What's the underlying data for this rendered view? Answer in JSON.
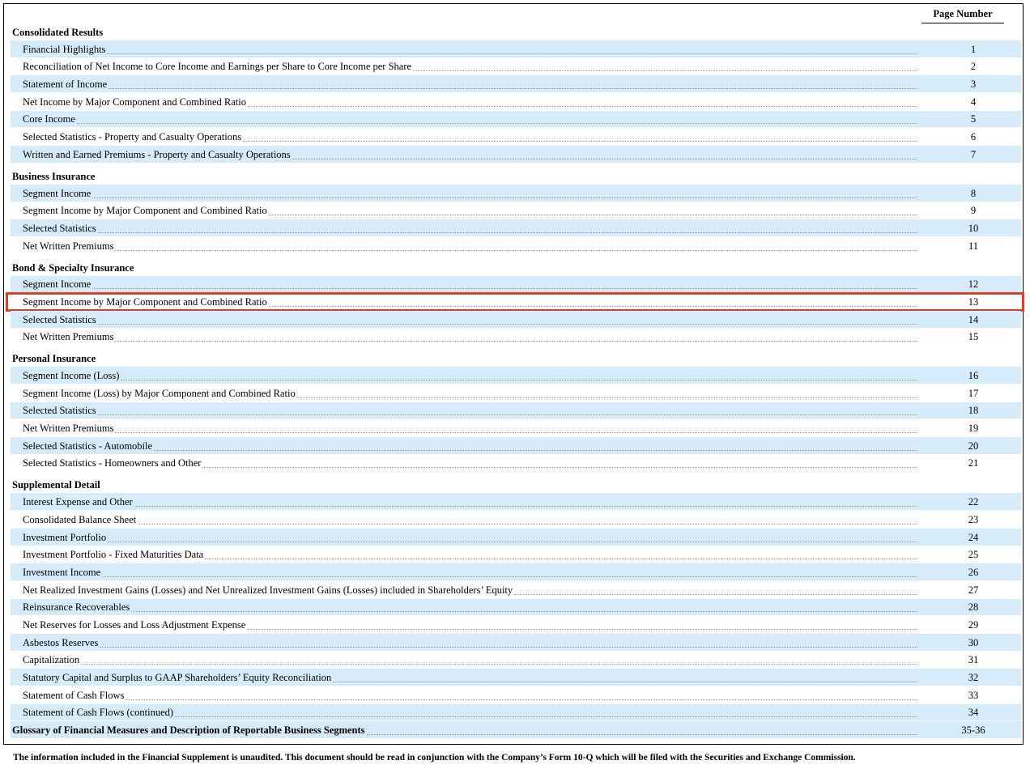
{
  "header": {
    "page_number_label": "Page Number"
  },
  "sections": [
    {
      "title": "Consolidated Results",
      "items": [
        {
          "label": "Financial Highlights",
          "page": "1"
        },
        {
          "label": "Reconciliation of Net Income to Core Income and Earnings per Share to Core Income per Share",
          "page": "2"
        },
        {
          "label": "Statement of Income",
          "page": "3"
        },
        {
          "label": "Net Income by Major Component and Combined Ratio",
          "page": "4"
        },
        {
          "label": "Core Income",
          "page": "5"
        },
        {
          "label": "Selected Statistics - Property and Casualty Operations",
          "page": "6"
        },
        {
          "label": "Written and Earned Premiums - Property and Casualty Operations",
          "page": "7"
        }
      ]
    },
    {
      "title": "Business Insurance",
      "items": [
        {
          "label": "Segment Income",
          "page": "8"
        },
        {
          "label": "Segment Income by Major Component and Combined Ratio",
          "page": "9"
        },
        {
          "label": "Selected Statistics",
          "page": "10"
        },
        {
          "label": "Net Written Premiums",
          "page": "11"
        }
      ]
    },
    {
      "title": "Bond & Specialty Insurance",
      "items": [
        {
          "label": "Segment Income",
          "page": "12"
        },
        {
          "label": "Segment Income by Major Component and Combined Ratio",
          "page": "13"
        },
        {
          "label": "Selected Statistics",
          "page": "14"
        },
        {
          "label": "Net Written Premiums",
          "page": "15"
        }
      ]
    },
    {
      "title": "Personal Insurance",
      "items": [
        {
          "label": "Segment Income (Loss)",
          "page": "16"
        },
        {
          "label": "Segment Income (Loss) by Major Component and Combined Ratio",
          "page": "17"
        },
        {
          "label": "Selected Statistics",
          "page": "18"
        },
        {
          "label": "Net Written Premiums",
          "page": "19"
        },
        {
          "label": "Selected Statistics - Automobile",
          "page": "20"
        },
        {
          "label": "Selected Statistics - Homeowners and Other",
          "page": "21"
        }
      ]
    },
    {
      "title": "Supplemental Detail",
      "items": [
        {
          "label": "Interest Expense and Other",
          "page": "22"
        },
        {
          "label": "Consolidated Balance Sheet",
          "page": "23"
        },
        {
          "label": "Investment Portfolio",
          "page": "24"
        },
        {
          "label": "Investment Portfolio - Fixed Maturities Data",
          "page": "25"
        },
        {
          "label": "Investment Income",
          "page": "26"
        },
        {
          "label": "Net Realized Investment Gains (Losses) and Net Unrealized Investment Gains (Losses) included in Shareholders’ Equity",
          "page": "27"
        },
        {
          "label": "Reinsurance Recoverables",
          "page": "28"
        },
        {
          "label": "Net Reserves for Losses and Loss Adjustment Expense",
          "page": "29"
        },
        {
          "label": "Asbestos Reserves",
          "page": "30"
        },
        {
          "label": "Capitalization",
          "page": "31"
        },
        {
          "label": "Statutory Capital and Surplus to GAAP Shareholders’ Equity Reconciliation",
          "page": "32"
        },
        {
          "label": "Statement of Cash Flows",
          "page": "33"
        },
        {
          "label": "Statement of Cash Flows (continued)",
          "page": "34"
        }
      ]
    }
  ],
  "glossary": {
    "label": "Glossary of Financial Measures and Description of Reportable Business Segments",
    "page": "35-36"
  },
  "highlighted_entry": {
    "section": "Bond & Specialty Insurance",
    "label": "Segment Income by Major Component and Combined Ratio",
    "page": "13"
  },
  "footnote": "The information included in the Financial Supplement is unaudited.  This document should be read in conjunction with the Company’s Form 10-Q which will be filed with the Securities and Exchange Commission.",
  "colors": {
    "row_shading": "#d6ecfb",
    "highlight_border": "#d9412b"
  }
}
